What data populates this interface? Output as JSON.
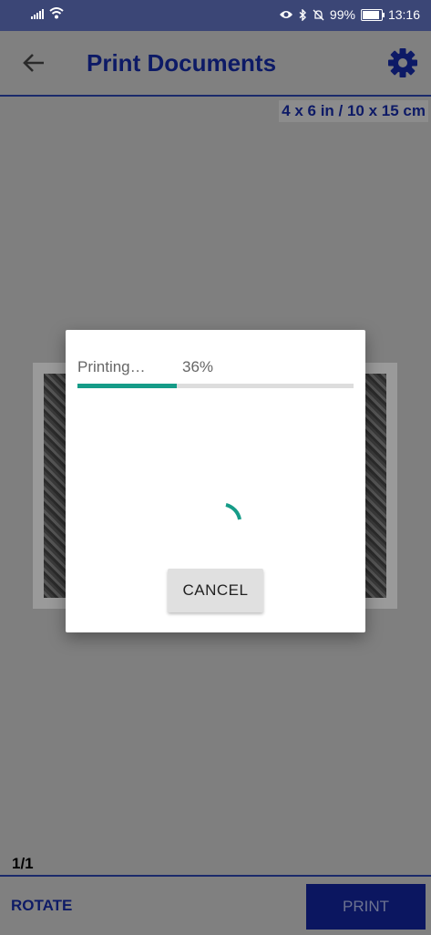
{
  "status_bar": {
    "battery": "99%",
    "time": "13:16"
  },
  "app_bar": {
    "title": "Print Documents"
  },
  "paper_size": "4 x 6 in / 10 x 15 cm",
  "dialog": {
    "status": "Printing…",
    "progress_text": "36%",
    "progress_fraction": 0.36,
    "cancel_label": "CANCEL"
  },
  "page_indicator": "1/1",
  "bottom_bar": {
    "rotate_label": "ROTATE",
    "print_label": "PRINT"
  },
  "colors": {
    "accent": "#169c88",
    "primary": "#0d1a66",
    "status_bar": "#3b4676"
  },
  "icons": [
    "signal-icon",
    "wifi-icon",
    "eye-icon",
    "bluetooth-icon",
    "mute-icon",
    "battery-icon",
    "back-arrow-icon",
    "gear-icon",
    "spinner-icon"
  ]
}
